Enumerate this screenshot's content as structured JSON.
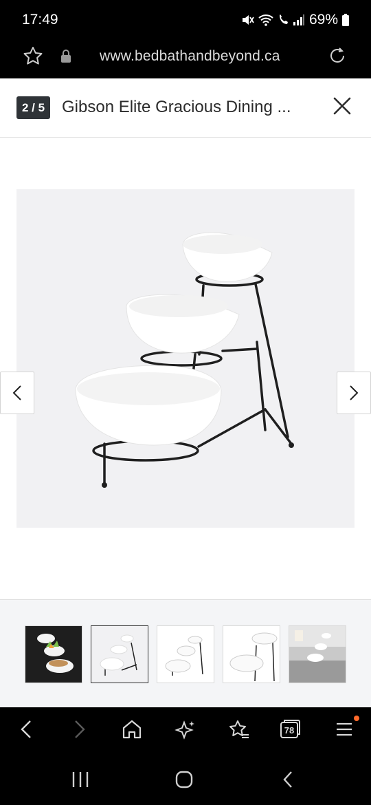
{
  "status": {
    "time": "17:49",
    "battery": "69%"
  },
  "browser": {
    "url": "www.bedbathandbeyond.ca",
    "tab_count": "78"
  },
  "gallery": {
    "counter": "2 / 5",
    "title": "Gibson Elite Gracious Dining ...",
    "thumbnails": [
      {
        "alt": "bowls-with-food-thumbnail"
      },
      {
        "alt": "tiered-bowls-thumbnail"
      },
      {
        "alt": "tiered-bowls-front-thumbnail"
      },
      {
        "alt": "bowls-closeup-thumbnail"
      },
      {
        "alt": "bowls-on-table-thumbnail"
      }
    ],
    "active_index": 1
  },
  "colors": {
    "counter_bg": "#2f3337",
    "accent_dot": "#ff6a2b"
  }
}
